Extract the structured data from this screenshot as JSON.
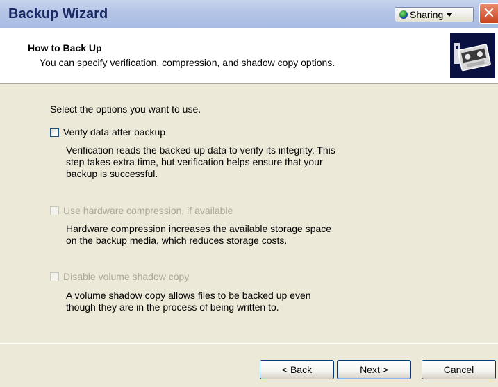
{
  "window": {
    "title": "Backup Wizard",
    "sharing_label": "Sharing",
    "close_glyph": "✕"
  },
  "header": {
    "title": "How to Back Up",
    "subtitle": "You can specify verification, compression, and shadow copy options.",
    "icon": "backup-tape-icon"
  },
  "main": {
    "prompt": "Select the options you want to use.",
    "options": [
      {
        "label": "Verify data after backup",
        "checked": false,
        "enabled": true,
        "description": "Verification reads the backed-up data to verify its integrity. This\nstep takes extra time, but verification helps ensure that your\nbackup is successful."
      },
      {
        "label": "Use hardware compression, if available",
        "checked": false,
        "enabled": false,
        "description": "Hardware compression increases the available storage space\non the backup media, which reduces storage costs."
      },
      {
        "label": "Disable volume shadow copy",
        "checked": false,
        "enabled": false,
        "description": "A volume shadow copy allows files to be backed up even\nthough they are in the process of being written to."
      }
    ]
  },
  "footer": {
    "back_label": "< Back",
    "next_label": "Next >",
    "cancel_label": "Cancel"
  },
  "colors": {
    "dialog_bg": "#ECE9D8",
    "title_text": "#1A2A66",
    "disabled_text": "#ACA899",
    "button_border": "#003C74"
  }
}
